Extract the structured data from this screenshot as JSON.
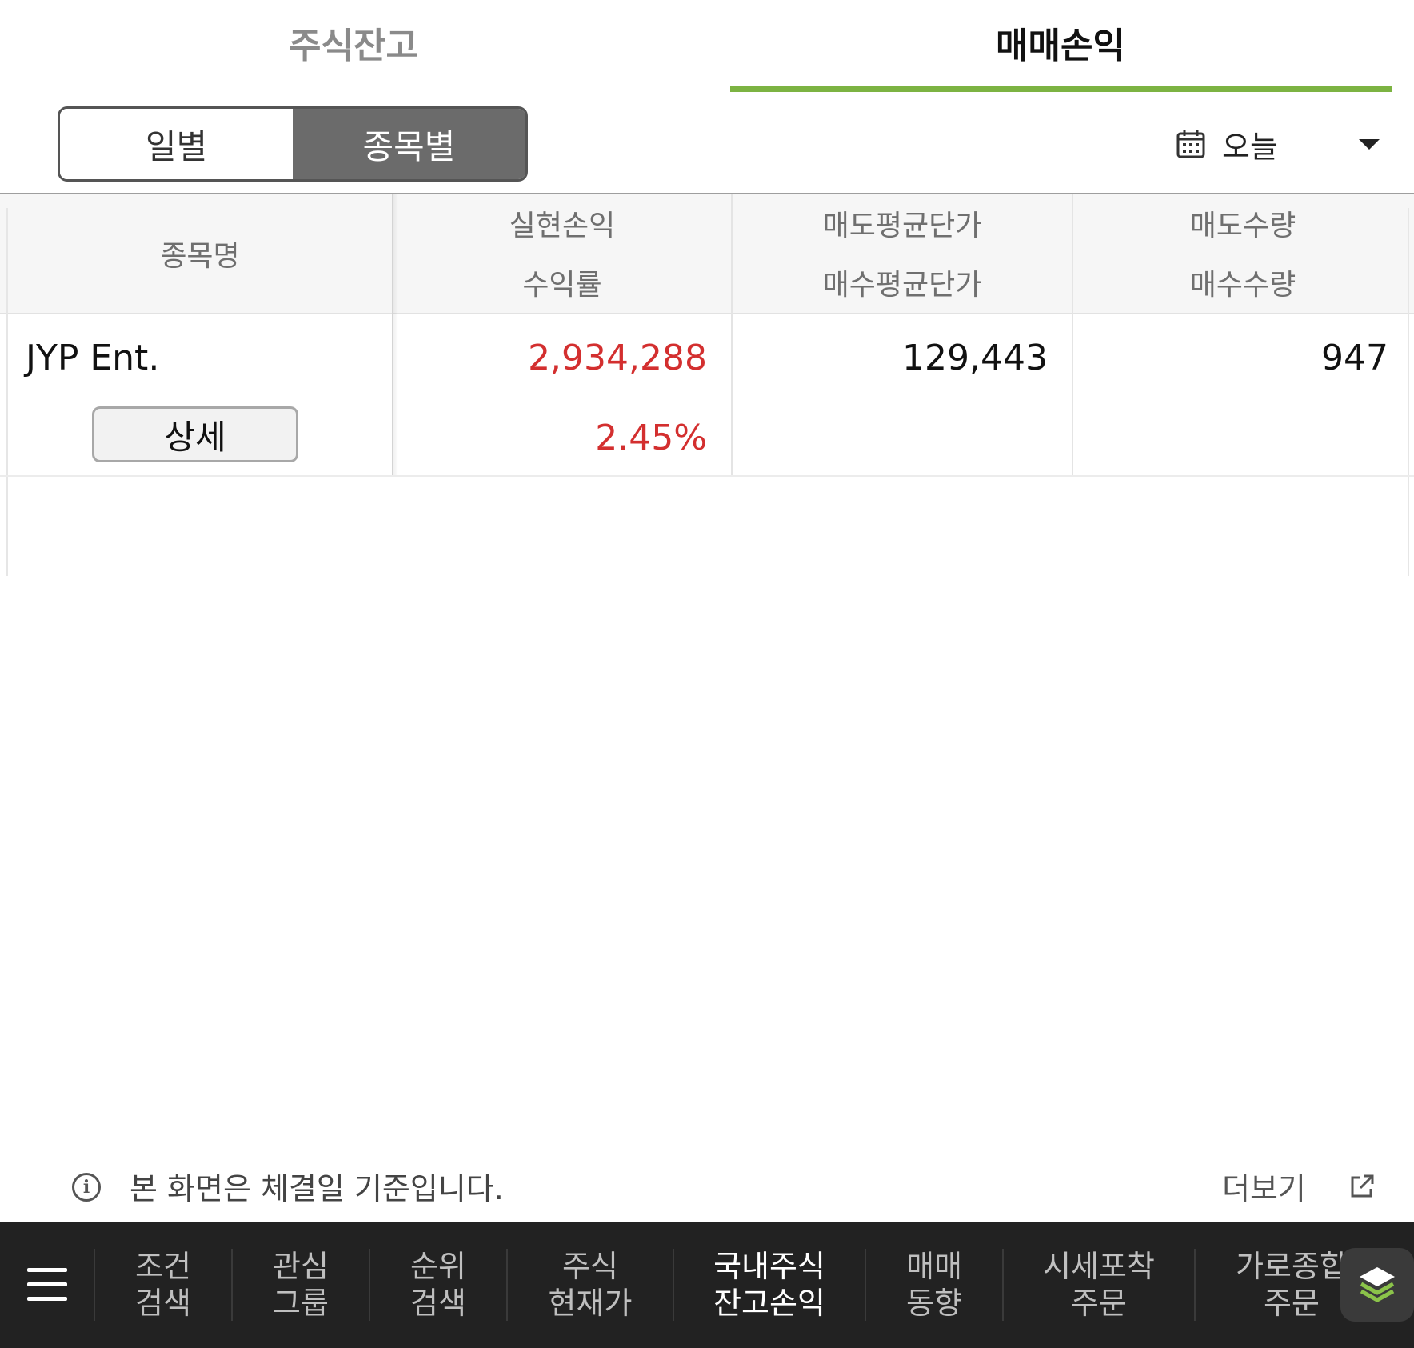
{
  "tabs": {
    "stock_balance": "주식잔고",
    "trade_pnl": "매매손익"
  },
  "segment": {
    "daily": "일별",
    "by_stock": "종목별"
  },
  "date_filter": {
    "icon": "calendar-icon",
    "value": "오늘"
  },
  "table": {
    "headers": {
      "name": "종목명",
      "realized_pnl": "실현손익",
      "return_rate": "수익률",
      "avg_sell_price": "매도평균단가",
      "avg_buy_price": "매수평균단가",
      "sell_qty": "매도수량",
      "buy_qty": "매수수량"
    },
    "rows": [
      {
        "name": "JYP Ent.",
        "detail_button": "상세",
        "realized_pnl": "2,934,288",
        "return_rate": "2.45%",
        "avg_sell_price": "129,443",
        "sell_qty": "947"
      }
    ]
  },
  "footer": {
    "notice": "본 화면은 체결일 기준입니다.",
    "more": "더보기"
  },
  "bottom_nav": {
    "items": [
      {
        "line1": "조건",
        "line2": "검색"
      },
      {
        "line1": "관심",
        "line2": "그룹"
      },
      {
        "line1": "순위",
        "line2": "검색"
      },
      {
        "line1": "주식",
        "line2": "현재가"
      },
      {
        "line1": "국내주식",
        "line2": "잔고손익"
      },
      {
        "line1": "매매",
        "line2": "동향"
      },
      {
        "line1": "시세포착",
        "line2": "주문"
      },
      {
        "line1": "가로종합",
        "line2": "주문"
      }
    ]
  },
  "colors": {
    "accent_green": "#7cb342",
    "profit_red": "#d32f2f",
    "nav_bg": "#222222"
  }
}
